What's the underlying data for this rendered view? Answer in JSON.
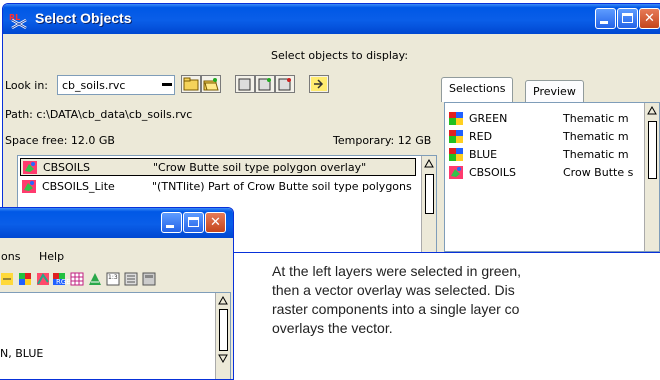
{
  "main_window": {
    "title": "Select Objects",
    "prompt": "Select objects to display:",
    "look_in_label": "Look in:",
    "look_in_value": "cb_soils.rvc",
    "path_label": "Path: c:\\DATA\\cb_data\\cb_soils.rvc",
    "space_free": "Space free:  12.0 GB",
    "temporary": "Temporary: 12 GB",
    "objects": [
      {
        "name": "CBSOILS",
        "desc": "\"Crow Butte soil type polygon overlay\""
      },
      {
        "name": "CBSOILS_Lite",
        "desc": "\"(TNTlite) Part of Crow Butte soil type polygons"
      }
    ],
    "tabs": [
      {
        "label": "Selections"
      },
      {
        "label": "Preview"
      }
    ],
    "selections": [
      {
        "name": "GREEN",
        "type": "Thematic m"
      },
      {
        "name": "RED",
        "type": "Thematic m"
      },
      {
        "name": "BLUE",
        "type": "Thematic m"
      },
      {
        "name": "CBSOILS",
        "type": "Crow Butte s"
      }
    ]
  },
  "second_window": {
    "menu_partial": "ons",
    "menu_help": "Help",
    "list_text": "N, BLUE"
  },
  "caption": {
    "line1": "At the left layers were selected in green,",
    "line2": "then a vector overlay was selected.  Dis",
    "line3": "raster components into a single layer co",
    "line4": "overlays the vector."
  }
}
